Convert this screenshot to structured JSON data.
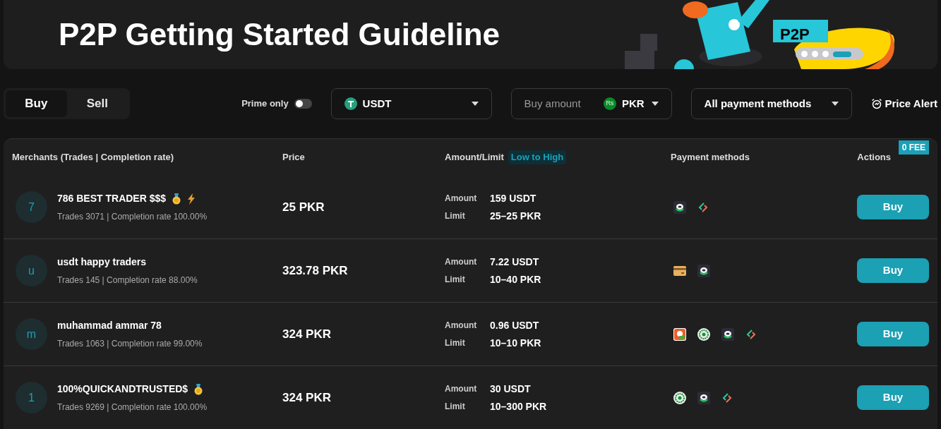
{
  "banner": {
    "title": "P2P Getting Started Guideline",
    "art_label": "P2P",
    "slides": [
      {
        "selected": false
      },
      {
        "selected": false
      },
      {
        "selected": false
      },
      {
        "selected": true
      }
    ]
  },
  "filters": {
    "tabs": [
      {
        "label": "Buy",
        "selected": true
      },
      {
        "label": "Sell",
        "selected": false
      }
    ],
    "prime_only": {
      "label": "Prime only",
      "on": false
    },
    "asset": {
      "value": "USDT"
    },
    "amount": {
      "placeholder": "Buy amount",
      "currency": "PKR",
      "currency_symbol": "Rs"
    },
    "payment": {
      "value": "All payment methods"
    },
    "price_alert": "Price Alert"
  },
  "table": {
    "columns": [
      "Merchants (Trades | Completion rate)",
      "Price",
      "Amount/Limit",
      "Payment methods",
      "Actions"
    ],
    "sort_badge": "Low to High",
    "fee_tag": "0 FEE",
    "rows": [
      {
        "avatar": "7",
        "name": "786 BEST TRADER $$$",
        "badges": [
          {
            "kind": "medal"
          },
          {
            "kind": "lightning"
          }
        ],
        "stats": "Trades 3071 | Completion rate 100.00%",
        "price": "25 PKR",
        "amount_label": "Amount",
        "amount": "159 USDT",
        "limit_label": "Limit",
        "limit": "25–25 PKR",
        "payment_methods": [
          {
            "kind": "ring"
          },
          {
            "kind": "link"
          }
        ],
        "action": "Buy"
      },
      {
        "avatar": "u",
        "name": "usdt happy traders",
        "badges": [],
        "stats": "Trades 145 | Completion rate 88.00%",
        "price": "323.78 PKR",
        "amount_label": "Amount",
        "amount": "7.22 USDT",
        "limit_label": "Limit",
        "limit": "10–40 PKR",
        "payment_methods": [
          {
            "kind": "card"
          },
          {
            "kind": "ring"
          }
        ],
        "action": "Buy"
      },
      {
        "avatar": "m",
        "name": "muhammad ammar 78",
        "badges": [],
        "stats": "Trades 1063 | Completion rate 99.00%",
        "price": "324 PKR",
        "amount_label": "Amount",
        "amount": "0.96 USDT",
        "limit_label": "Limit",
        "limit": "10–10 PKR",
        "payment_methods": [
          {
            "kind": "orange"
          },
          {
            "kind": "seal"
          },
          {
            "kind": "ring"
          },
          {
            "kind": "link"
          }
        ],
        "action": "Buy"
      },
      {
        "avatar": "1",
        "name": "100%QUICKANDTRUSTED$",
        "badges": [
          {
            "kind": "medal"
          }
        ],
        "stats": "Trades 9269 | Completion rate 100.00%",
        "price": "324 PKR",
        "amount_label": "Amount",
        "amount": "30 USDT",
        "limit_label": "Limit",
        "limit": "10–300 PKR",
        "payment_methods": [
          {
            "kind": "seal"
          },
          {
            "kind": "ring"
          },
          {
            "kind": "link"
          }
        ],
        "action": "Buy"
      }
    ]
  }
}
